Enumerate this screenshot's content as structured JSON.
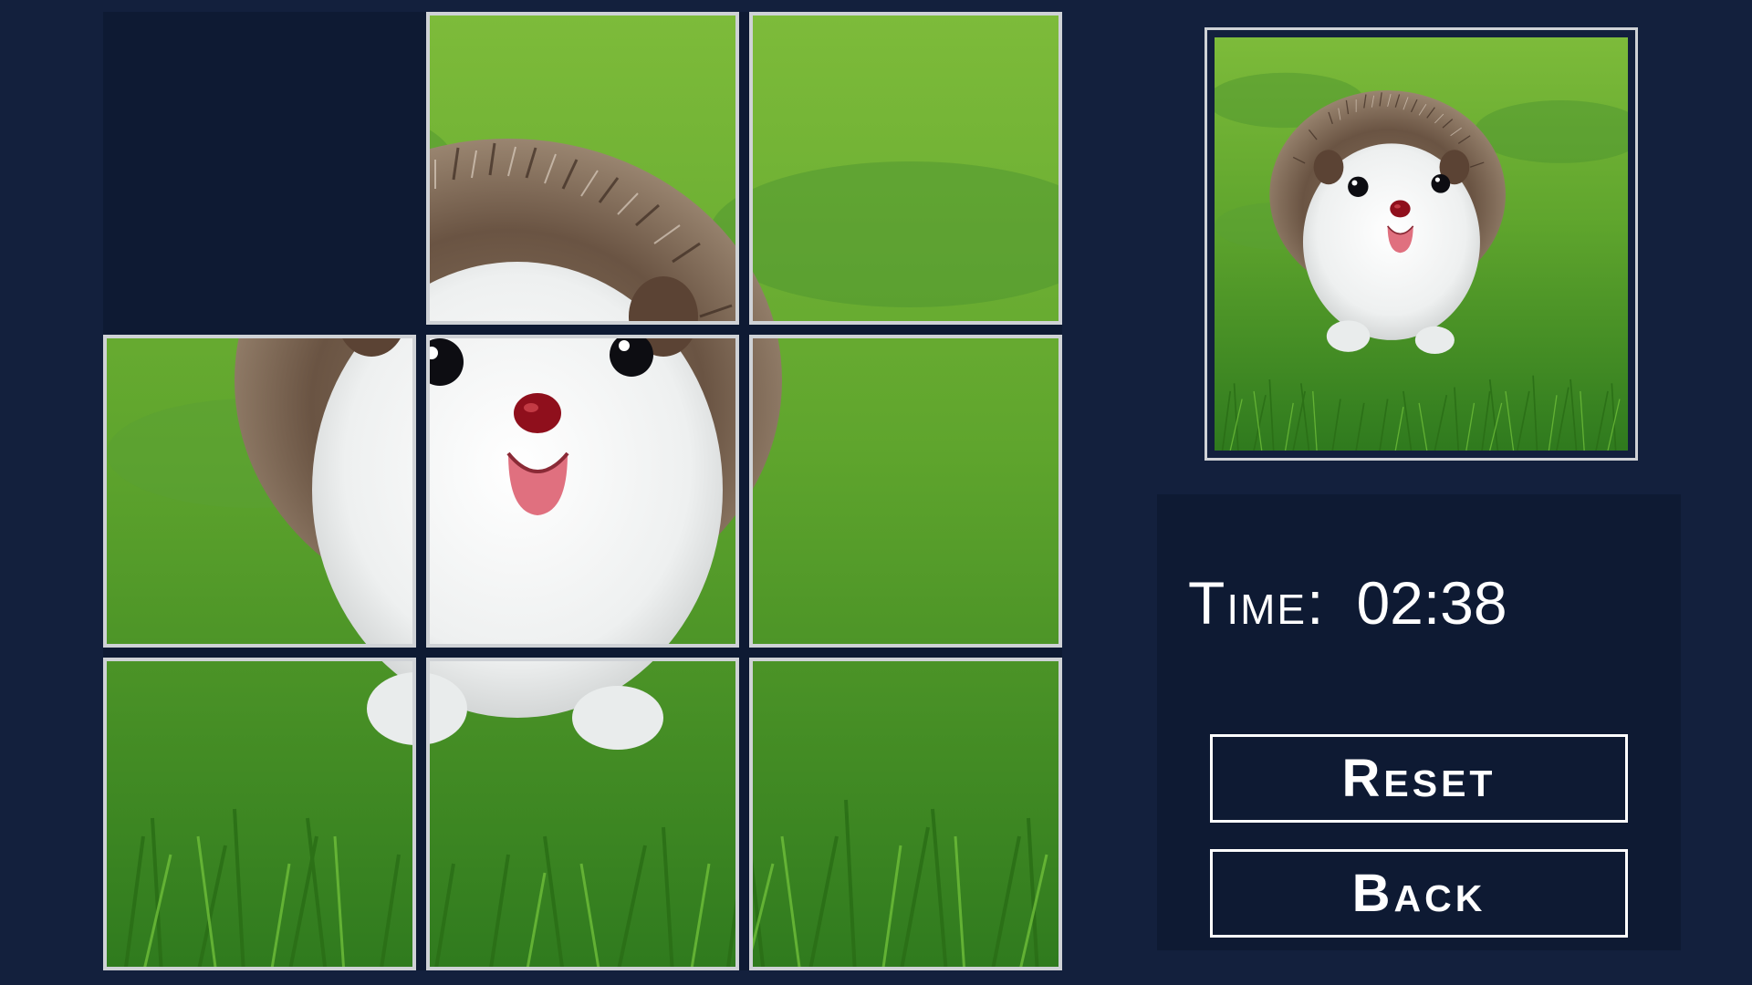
{
  "game": {
    "puzzle_size": "3x3",
    "empty_tile_position": 1,
    "tile_order": [
      0,
      2,
      3,
      4,
      5,
      6,
      7,
      8,
      9
    ],
    "picture": "hedgehog-on-grass"
  },
  "timer": {
    "label": "Time:",
    "value": "02:38"
  },
  "buttons": {
    "reset_label": "Reset",
    "back_label": "Back"
  },
  "colors": {
    "background": "#13203d",
    "panel": "#0e1a33",
    "tile_border": "#cfd2d6",
    "text": "#ffffff",
    "grass": "#4f9a33"
  }
}
